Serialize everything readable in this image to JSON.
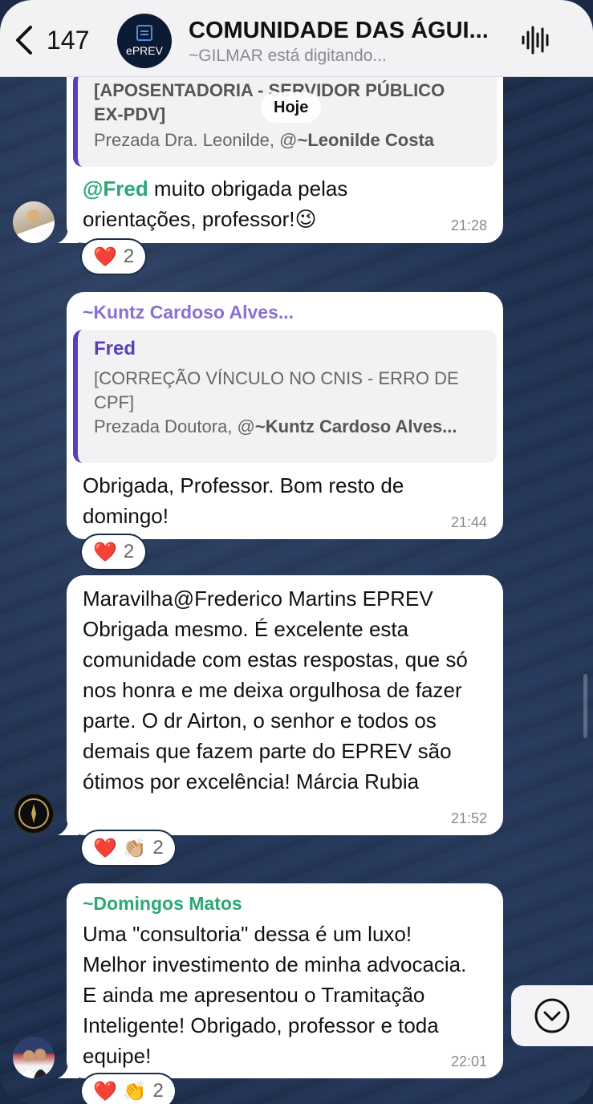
{
  "header": {
    "back_count": "147",
    "group_logo_text": "ePREV",
    "title": "COMUNIDADE DAS ÁGUI...",
    "status": "~GILMAR está digitando..."
  },
  "date_divider": "Hoje",
  "messages": [
    {
      "quote_title": "[APOSENTADORIA - SERVIDOR PÚBLICO EX-PDV]",
      "quote_body_prefix": "Prezada Dra. Leonilde, @",
      "quote_body_mention": "~Leonilde Costa",
      "mention": "@Fred",
      "text": " muito obrigada pelas orientações,  professor!😉",
      "time": "21:28",
      "reactions": "❤️",
      "reaction_count": "2"
    },
    {
      "sender": "~Kuntz Cardoso Alves...",
      "quote_name": "Fred",
      "quote_title": "[CORREÇÃO VÍNCULO NO CNIS - ERRO DE CPF]",
      "quote_body_prefix": "Prezada Doutora, @",
      "quote_body_mention": "~Kuntz Cardoso Alves...",
      "text": "Obrigada, Professor. Bom resto de domingo!",
      "time": "21:44",
      "reactions": "❤️",
      "reaction_count": "2"
    },
    {
      "text": "Maravilha@Frederico Martins EPREV Obrigada mesmo. É excelente esta comunidade com estas respostas, que só nos honra e me deixa orgulhosa de fazer parte. O dr Airton, o senhor e todos os demais que fazem parte do EPREV são ótimos por excelência! Márcia Rubia",
      "time": "21:52",
      "reactions": "❤️ 👏🏼",
      "reaction_count": "2"
    },
    {
      "sender": "~Domingos Matos",
      "text": "Uma \"consultoria\" dessa é um luxo! Melhor investimento de minha advocacia. E ainda me apresentou o Tramitação Inteligente! Obrigado, professor e toda equipe!",
      "time": "22:01",
      "reactions": "❤️ 👏",
      "reaction_count": "2"
    }
  ],
  "colors": {
    "header_bg": "#f2f2f4",
    "chat_bg": "#1d2d49",
    "quote_accent": "#5b3fb8",
    "mention_green": "#2aa876",
    "sender_purple": "#8a6fd6",
    "sender_green": "#2aa876"
  },
  "icons": {
    "back": "chevron-left-icon",
    "audio": "waveform-icon",
    "scroll_down": "chevron-down-circle-icon"
  }
}
